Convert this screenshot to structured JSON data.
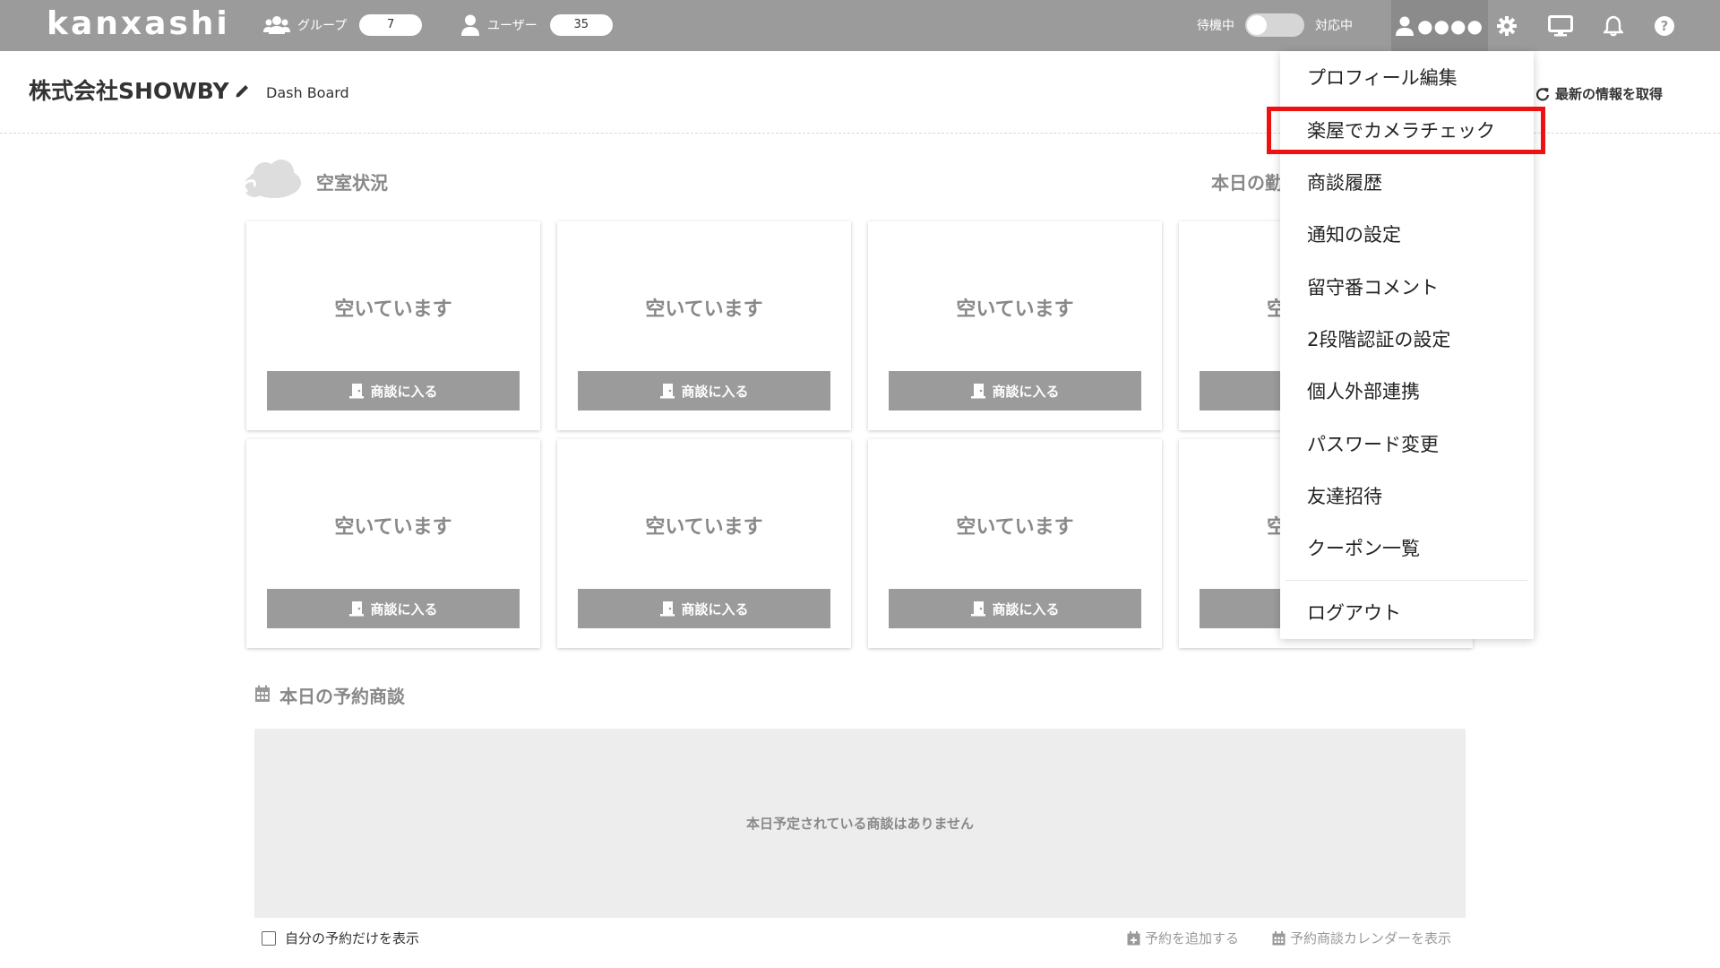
{
  "topbar": {
    "logo": "kanxashi",
    "groups": {
      "label": "グループ",
      "count": "7"
    },
    "users": {
      "label": "ユーザー",
      "count": "35"
    },
    "status": {
      "standby": "待機中",
      "active": "対応中"
    },
    "username": "●●●●",
    "icons": [
      "users-icon",
      "user-icon",
      "settings-icon",
      "monitor-icon",
      "bell-icon",
      "help-icon"
    ]
  },
  "header": {
    "company": "株式会社SHOWBY",
    "breadcrumb": "Dash Board",
    "refresh": "最新の情報を取得"
  },
  "rooms": {
    "title": "空室状況",
    "attendance_title": "本日の勤",
    "cards": [
      {
        "status": "空いています",
        "button": "商談に入る"
      },
      {
        "status": "空いています",
        "button": "商談に入る"
      },
      {
        "status": "空いています",
        "button": "商談に入る"
      },
      {
        "status": "空",
        "button": ""
      },
      {
        "status": "空いています",
        "button": "商談に入る"
      },
      {
        "status": "空いています",
        "button": "商談に入る"
      },
      {
        "status": "空いています",
        "button": "商談に入る"
      },
      {
        "status": "空",
        "button": ""
      }
    ]
  },
  "reservations": {
    "title": "本日の予約商談",
    "empty": "本日予定されている商談はありません",
    "only_mine": "自分の予約だけを表示",
    "add": "予約を追加する",
    "calendar": "予約商談カレンダーを表示"
  },
  "menu": {
    "items": [
      "プロフィール編集",
      "楽屋でカメラチェック",
      "商談履歴",
      "通知の設定",
      "留守番コメント",
      "2段階認証の設定",
      "個人外部連携",
      "パスワード変更",
      "友達招待",
      "クーポン一覧",
      "ログアウト"
    ],
    "highlighted_index": 1,
    "highlight_color": "#ee1111"
  },
  "colors": {
    "topbar": "#9b9b9b",
    "button": "#9b9b9b",
    "muted_text": "#888888"
  }
}
